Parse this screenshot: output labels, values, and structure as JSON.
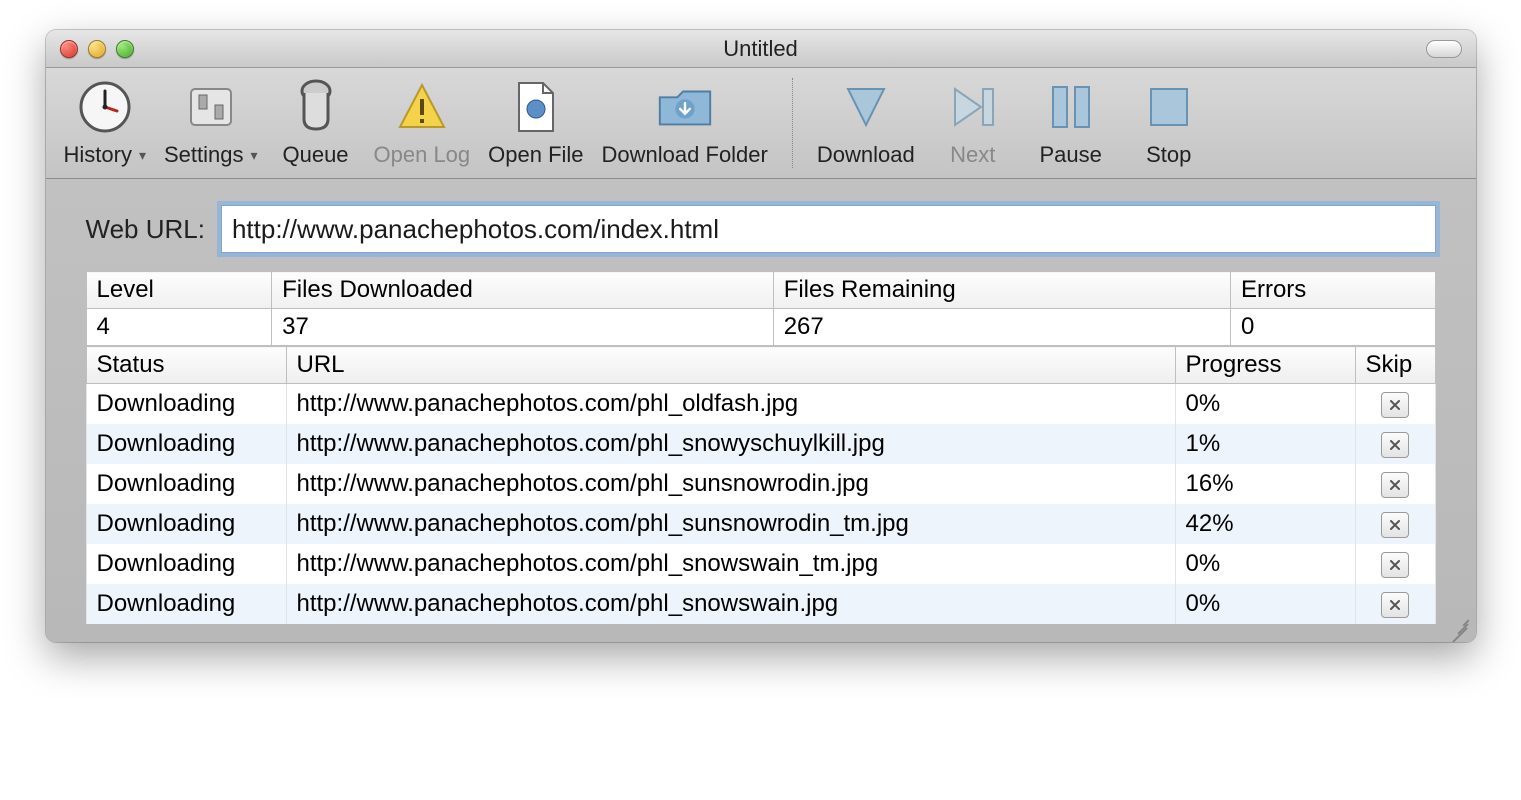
{
  "window": {
    "title": "Untitled"
  },
  "toolbar": {
    "history": "History",
    "settings": "Settings",
    "queue": "Queue",
    "open_log": "Open Log",
    "open_file": "Open File",
    "download_folder": "Download Folder",
    "download": "Download",
    "next": "Next",
    "pause": "Pause",
    "stop": "Stop"
  },
  "url_field": {
    "label": "Web URL:",
    "value": "http://www.panachephotos.com/index.html"
  },
  "stats": {
    "headers": {
      "level": "Level",
      "files_downloaded": "Files Downloaded",
      "files_remaining": "Files Remaining",
      "errors": "Errors"
    },
    "values": {
      "level": "4",
      "files_downloaded": "37",
      "files_remaining": "267",
      "errors": "0"
    }
  },
  "downloads": {
    "headers": {
      "status": "Status",
      "url": "URL",
      "progress": "Progress",
      "skip": "Skip"
    },
    "rows": [
      {
        "status": "Downloading",
        "url": "http://www.panachephotos.com/phl_oldfash.jpg",
        "progress": "0%"
      },
      {
        "status": "Downloading",
        "url": "http://www.panachephotos.com/phl_snowyschuylkill.jpg",
        "progress": "1%"
      },
      {
        "status": "Downloading",
        "url": "http://www.panachephotos.com/phl_sunsnowrodin.jpg",
        "progress": "16%"
      },
      {
        "status": "Downloading",
        "url": "http://www.panachephotos.com/phl_sunsnowrodin_tm.jpg",
        "progress": "42%"
      },
      {
        "status": "Downloading",
        "url": "http://www.panachephotos.com/phl_snowswain_tm.jpg",
        "progress": "0%"
      },
      {
        "status": "Downloading",
        "url": "http://www.panachephotos.com/phl_snowswain.jpg",
        "progress": "0%"
      }
    ]
  }
}
